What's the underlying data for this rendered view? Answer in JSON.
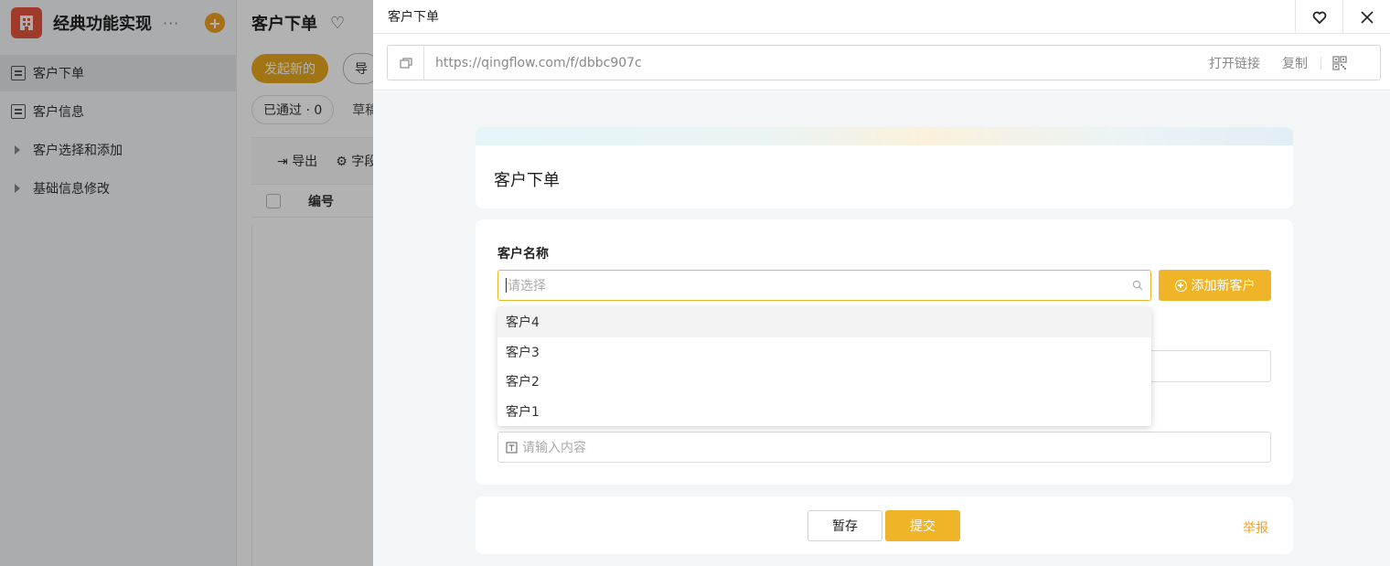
{
  "sidebar": {
    "app_name": "经典功能实现",
    "more": "···",
    "add": "+",
    "items": [
      {
        "label": "客户下单"
      },
      {
        "label": "客户信息"
      },
      {
        "label": "客户选择和添加"
      },
      {
        "label": "基础信息修改"
      }
    ]
  },
  "main": {
    "title": "客户下单",
    "new_button": "发起新的",
    "import_button": "导",
    "status_chip": "已通过 · 0",
    "draft_tab": "草稿",
    "export_action": "导出",
    "fields_action": "字段",
    "col_number": "编号"
  },
  "drawer": {
    "title": "客户下单",
    "url": "https://qingflow.com/f/dbbc907c",
    "open_link": "打开链接",
    "copy": "复制",
    "form_title": "客户下单",
    "customer_field": {
      "label": "客户名称",
      "placeholder": "请选择",
      "add_button": "添加新客户",
      "options": [
        "客户4",
        "客户3",
        "客户2",
        "客户1"
      ]
    },
    "text_field": {
      "placeholder": "请输入内容"
    },
    "save_button": "暂存",
    "submit_button": "提交",
    "report_link": "举报"
  }
}
